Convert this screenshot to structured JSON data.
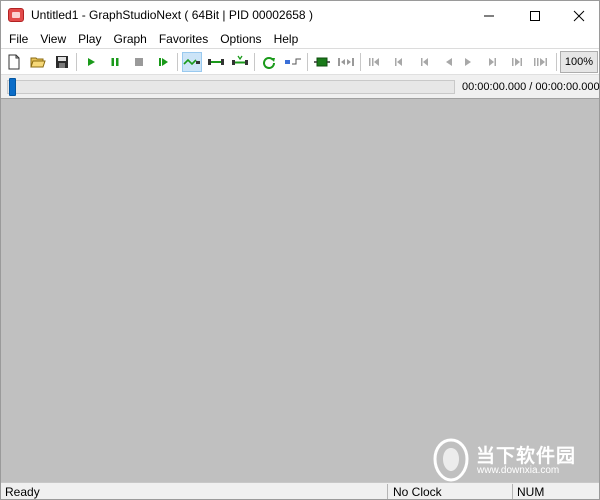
{
  "window": {
    "title": "Untitled1 - GraphStudioNext ( 64Bit | PID 00002658 )",
    "app_icon": "graphstudio-app-icon"
  },
  "menu": [
    "File",
    "View",
    "Play",
    "Graph",
    "Favorites",
    "Options",
    "Help"
  ],
  "toolbar": {
    "icons": [
      "new-file-icon",
      "open-folder-icon",
      "save-icon",
      "play-icon",
      "pause-icon",
      "stop-icon",
      "step-frame-icon",
      "connect-mode-icon",
      "link-icon",
      "smart-connect-icon",
      "refresh-icon",
      "insert-filter-icon",
      "render-icon",
      "seek-icon",
      "seek-start-icon",
      "seek-back-large-icon",
      "seek-back-icon",
      "frame-back-icon",
      "frame-forward-icon",
      "seek-forward-icon",
      "seek-forward-large-icon",
      "seek-end-icon"
    ],
    "zoom": "100%"
  },
  "seek": {
    "time": "00:00:00.000 / 00:00:00.000",
    "progress": 0
  },
  "watermark": {
    "text": "当下软件园",
    "url": "www.downxia.com"
  },
  "status": {
    "left": "Ready",
    "clock": "No Clock",
    "num": "NUM"
  },
  "colors": {
    "canvas": "#c0c0c0",
    "accent_green": "#1a9a1a",
    "seek_thumb": "#0a6cc8"
  }
}
